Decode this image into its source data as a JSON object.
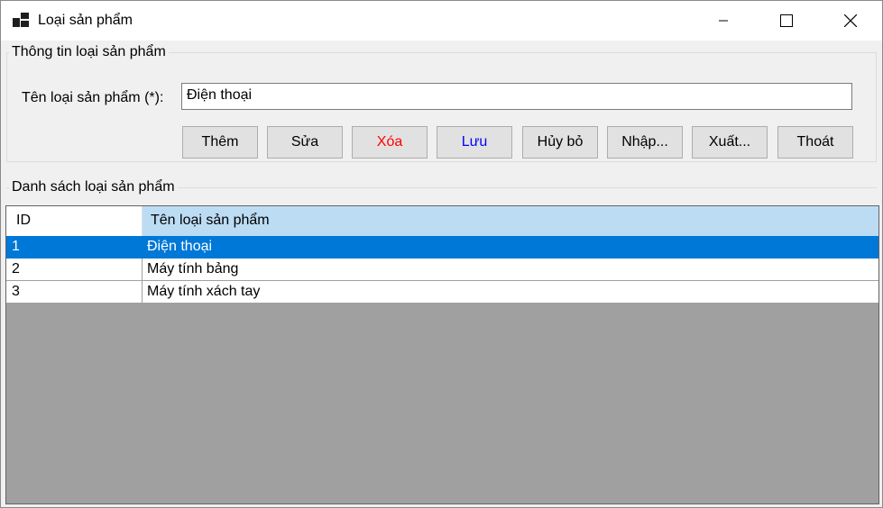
{
  "window": {
    "title": "Loại sản phẩm"
  },
  "info_group": {
    "legend": "Thông tin loại sản phẩm",
    "name_label": "Tên loại sản phẩm (*):",
    "name_value": "Điện thoại"
  },
  "buttons": [
    {
      "label": "Thêm",
      "color": "#000000"
    },
    {
      "label": "Sửa",
      "color": "#000000"
    },
    {
      "label": "Xóa",
      "color": "#ff0000"
    },
    {
      "label": "Lưu",
      "color": "#0000ff"
    },
    {
      "label": "Hủy bỏ",
      "color": "#000000"
    },
    {
      "label": "Nhập...",
      "color": "#000000"
    },
    {
      "label": "Xuất...",
      "color": "#000000"
    },
    {
      "label": "Thoát",
      "color": "#000000"
    }
  ],
  "list_group": {
    "legend": "Danh sách loại sản phẩm",
    "columns": [
      "ID",
      "Tên loại sản phẩm"
    ],
    "rows": [
      {
        "id": "1",
        "name": "Điện thoại",
        "selected": true
      },
      {
        "id": "2",
        "name": "Máy tính bảng",
        "selected": false
      },
      {
        "id": "3",
        "name": "Máy tính xách tay",
        "selected": false
      }
    ]
  },
  "colors": {
    "selection": "#0078d7",
    "header": "#bcdcf4",
    "grid_background": "#a0a0a0"
  }
}
